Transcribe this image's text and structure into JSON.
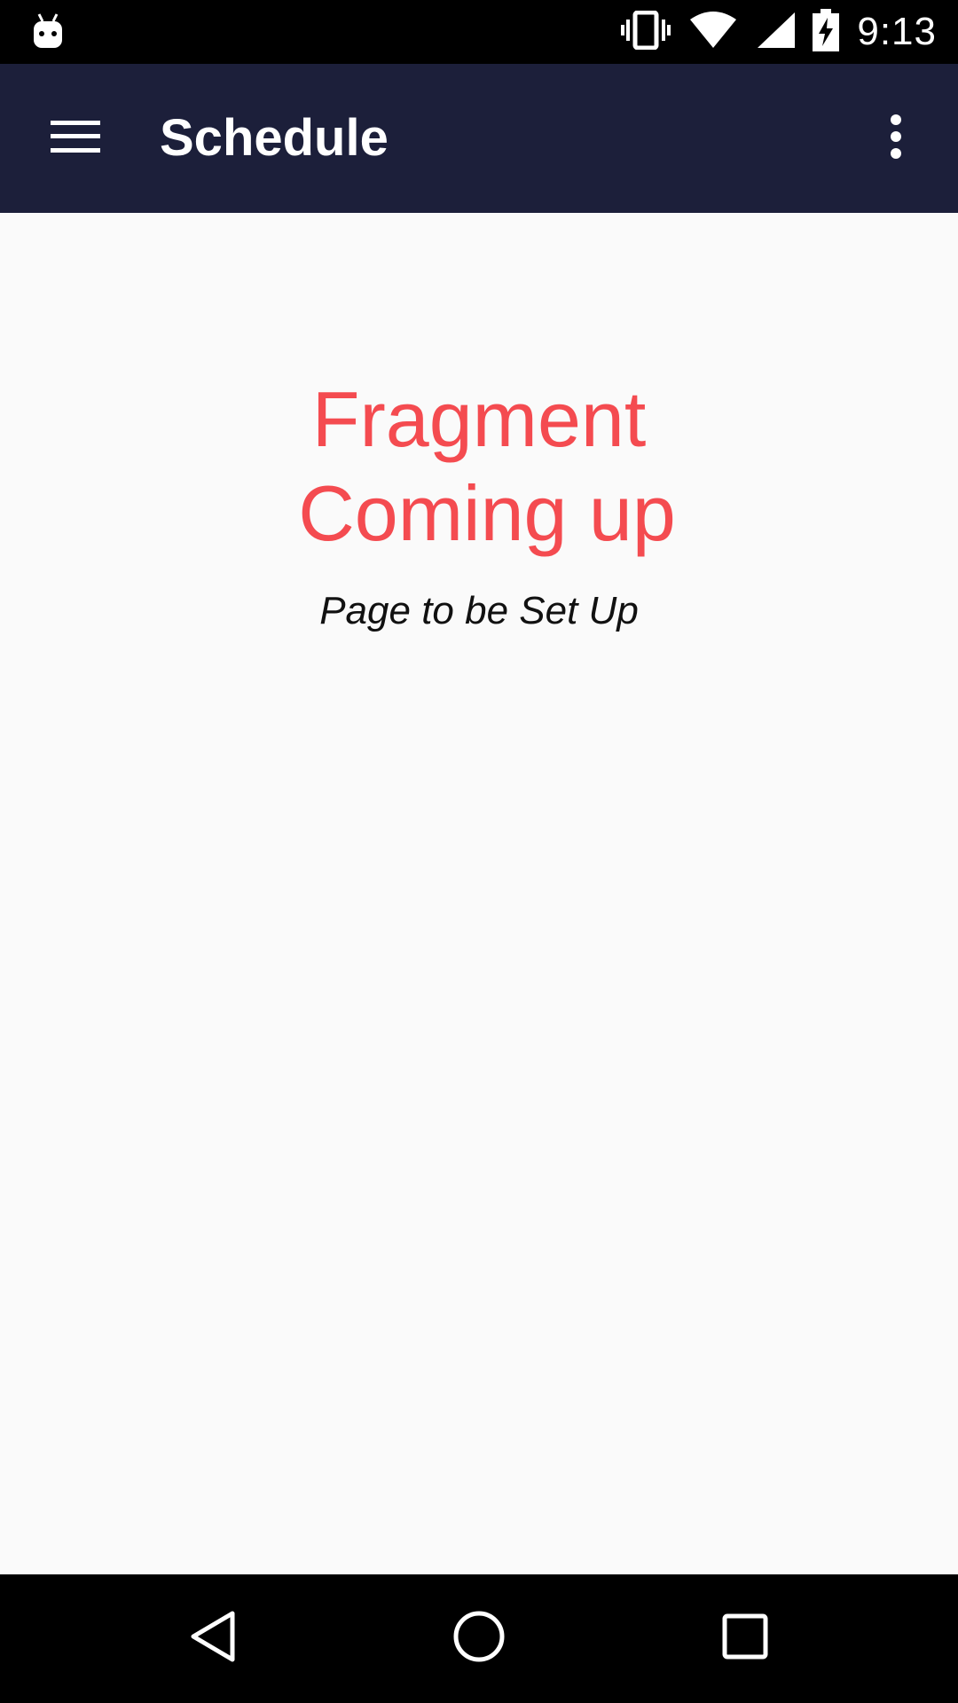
{
  "status_bar": {
    "time": "9:13",
    "icons": [
      "android-debug-icon",
      "vibrate-icon",
      "wifi-icon",
      "cell-signal-icon",
      "battery-charging-icon"
    ]
  },
  "toolbar": {
    "title": "Schedule",
    "menu_icon": "hamburger-menu-icon",
    "overflow_icon": "more-vert-icon",
    "background": "#1c1f3a"
  },
  "content": {
    "headline_line1": "Fragment",
    "headline_line2": "Coming up",
    "subtitle": "Page to be Set Up",
    "headline_color": "#f44b50"
  },
  "nav_bar": {
    "back_icon": "back-triangle-icon",
    "home_icon": "home-circle-icon",
    "recents_icon": "recents-square-icon"
  }
}
